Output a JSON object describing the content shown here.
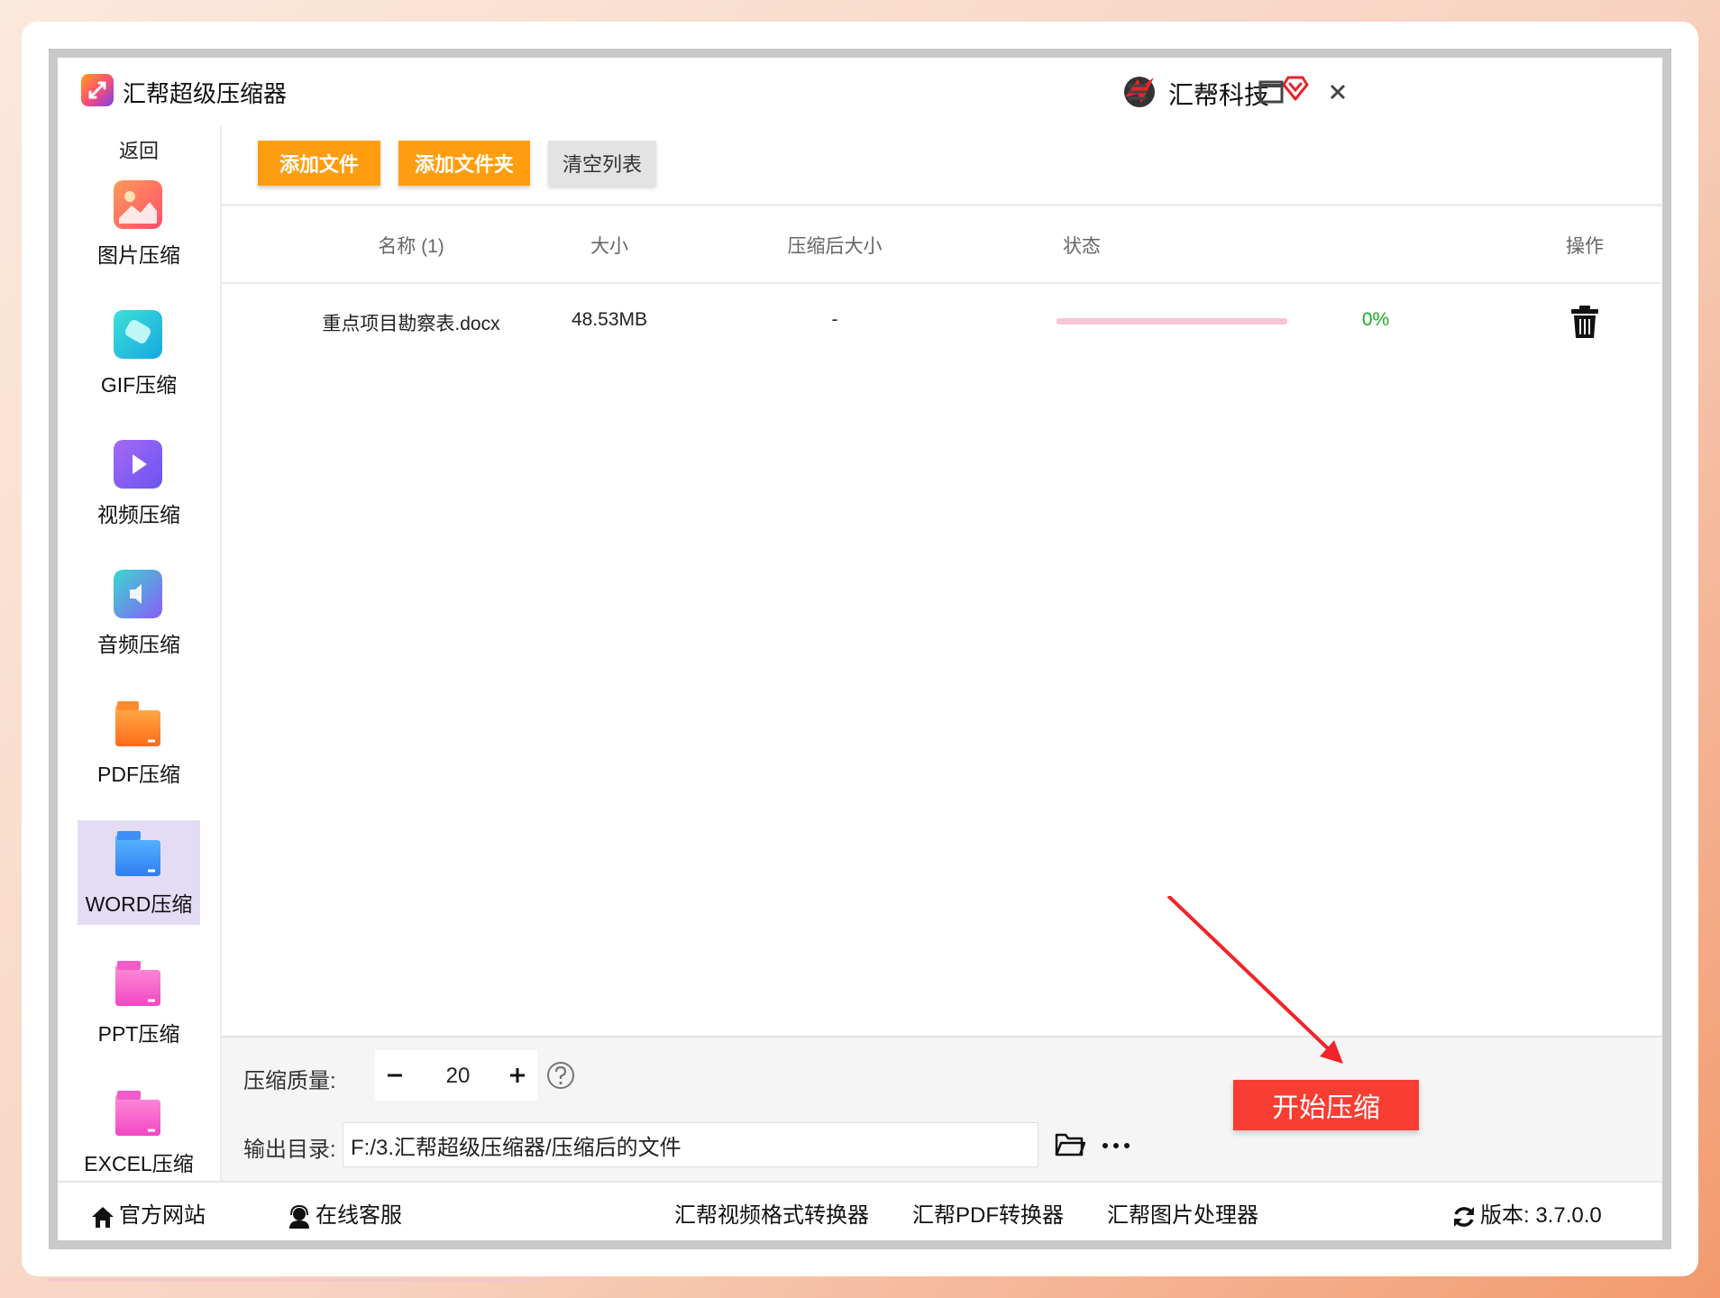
{
  "window": {
    "app_title": "汇帮超级压缩器",
    "brand_name": "汇帮科技"
  },
  "sidebar": {
    "back_label": "返回",
    "items": [
      {
        "label": "图片压缩",
        "icon": "image-icon"
      },
      {
        "label": "GIF压缩",
        "icon": "gif-icon"
      },
      {
        "label": "视频压缩",
        "icon": "video-icon"
      },
      {
        "label": "音频压缩",
        "icon": "audio-icon"
      },
      {
        "label": "PDF压缩",
        "icon": "pdf-icon"
      },
      {
        "label": "WORD压缩",
        "icon": "word-icon",
        "active": true
      },
      {
        "label": "PPT压缩",
        "icon": "ppt-icon"
      },
      {
        "label": "EXCEL压缩",
        "icon": "excel-icon"
      }
    ]
  },
  "toolbar": {
    "add_file": "添加文件",
    "add_folder": "添加文件夹",
    "clear_list": "清空列表"
  },
  "table": {
    "headers": {
      "name": "名称 (1)",
      "size": "大小",
      "compressed_size": "压缩后大小",
      "status": "状态",
      "action": "操作"
    },
    "rows": [
      {
        "name": "重点项目勘察表.docx",
        "size": "48.53MB",
        "compressed_size": "-",
        "progress_percent": 0,
        "progress_label": "0%"
      }
    ]
  },
  "settings": {
    "quality_label": "压缩质量:",
    "quality_value": "20",
    "output_label": "输出目录:",
    "output_path": "F:/3.汇帮超级压缩器/压缩后的文件",
    "start_button": "开始压缩"
  },
  "footer": {
    "website": "官方网站",
    "support": "在线客服",
    "links": [
      "汇帮视频格式转换器",
      "汇帮PDF转换器",
      "汇帮图片处理器"
    ],
    "version": "版本: 3.7.0.0"
  },
  "colors": {
    "accent_orange": "#ff9d10",
    "start_red": "#f83d32",
    "progress_pink": "#f8a7c2",
    "status_green": "#1aaa22",
    "active_sidebar": "#e4dcf5"
  }
}
